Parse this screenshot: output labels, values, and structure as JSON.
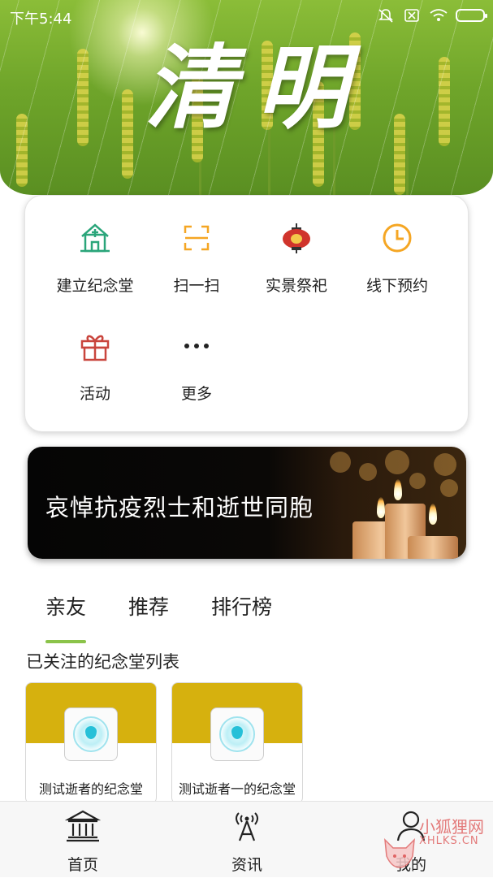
{
  "status_bar": {
    "time": "下午5:44",
    "icons": [
      "mute-icon",
      "no-sim-icon",
      "wifi-icon",
      "battery-icon"
    ]
  },
  "banner": {
    "title": "清明"
  },
  "menu": {
    "items": [
      {
        "label": "建立纪念堂",
        "icon": "memorial-hall-icon",
        "color": "#2aa57a"
      },
      {
        "label": "扫一扫",
        "icon": "scan-icon",
        "color": "#f5a623"
      },
      {
        "label": "实景祭祀",
        "icon": "lantern-icon",
        "color": "#d0342c"
      },
      {
        "label": "线下预约",
        "icon": "clock-icon",
        "color": "#f5a623"
      },
      {
        "label": "活动",
        "icon": "gift-icon",
        "color": "#c9453d"
      },
      {
        "label": "更多",
        "icon": "more-icon",
        "color": "#222222"
      }
    ]
  },
  "promo": {
    "text": "哀悼抗疫烈士和逝世同胞"
  },
  "tabs": [
    {
      "label": "亲友",
      "active": true
    },
    {
      "label": "推荐",
      "active": false
    },
    {
      "label": "排行榜",
      "active": false
    }
  ],
  "section": {
    "title": "已关注的纪念堂列表"
  },
  "halls": [
    {
      "name": "测试逝者的纪念堂"
    },
    {
      "name": "测试逝者一的纪念堂"
    }
  ],
  "bottom_nav": [
    {
      "label": "首页",
      "icon": "bank-icon"
    },
    {
      "label": "资讯",
      "icon": "broadcast-icon"
    },
    {
      "label": "我的",
      "icon": "user-icon"
    }
  ],
  "watermark": {
    "title": "小狐狸网",
    "subtitle": "XHLKS.CN"
  },
  "colors": {
    "accent": "#8bc34a",
    "hall_card": "#d6b10e"
  }
}
